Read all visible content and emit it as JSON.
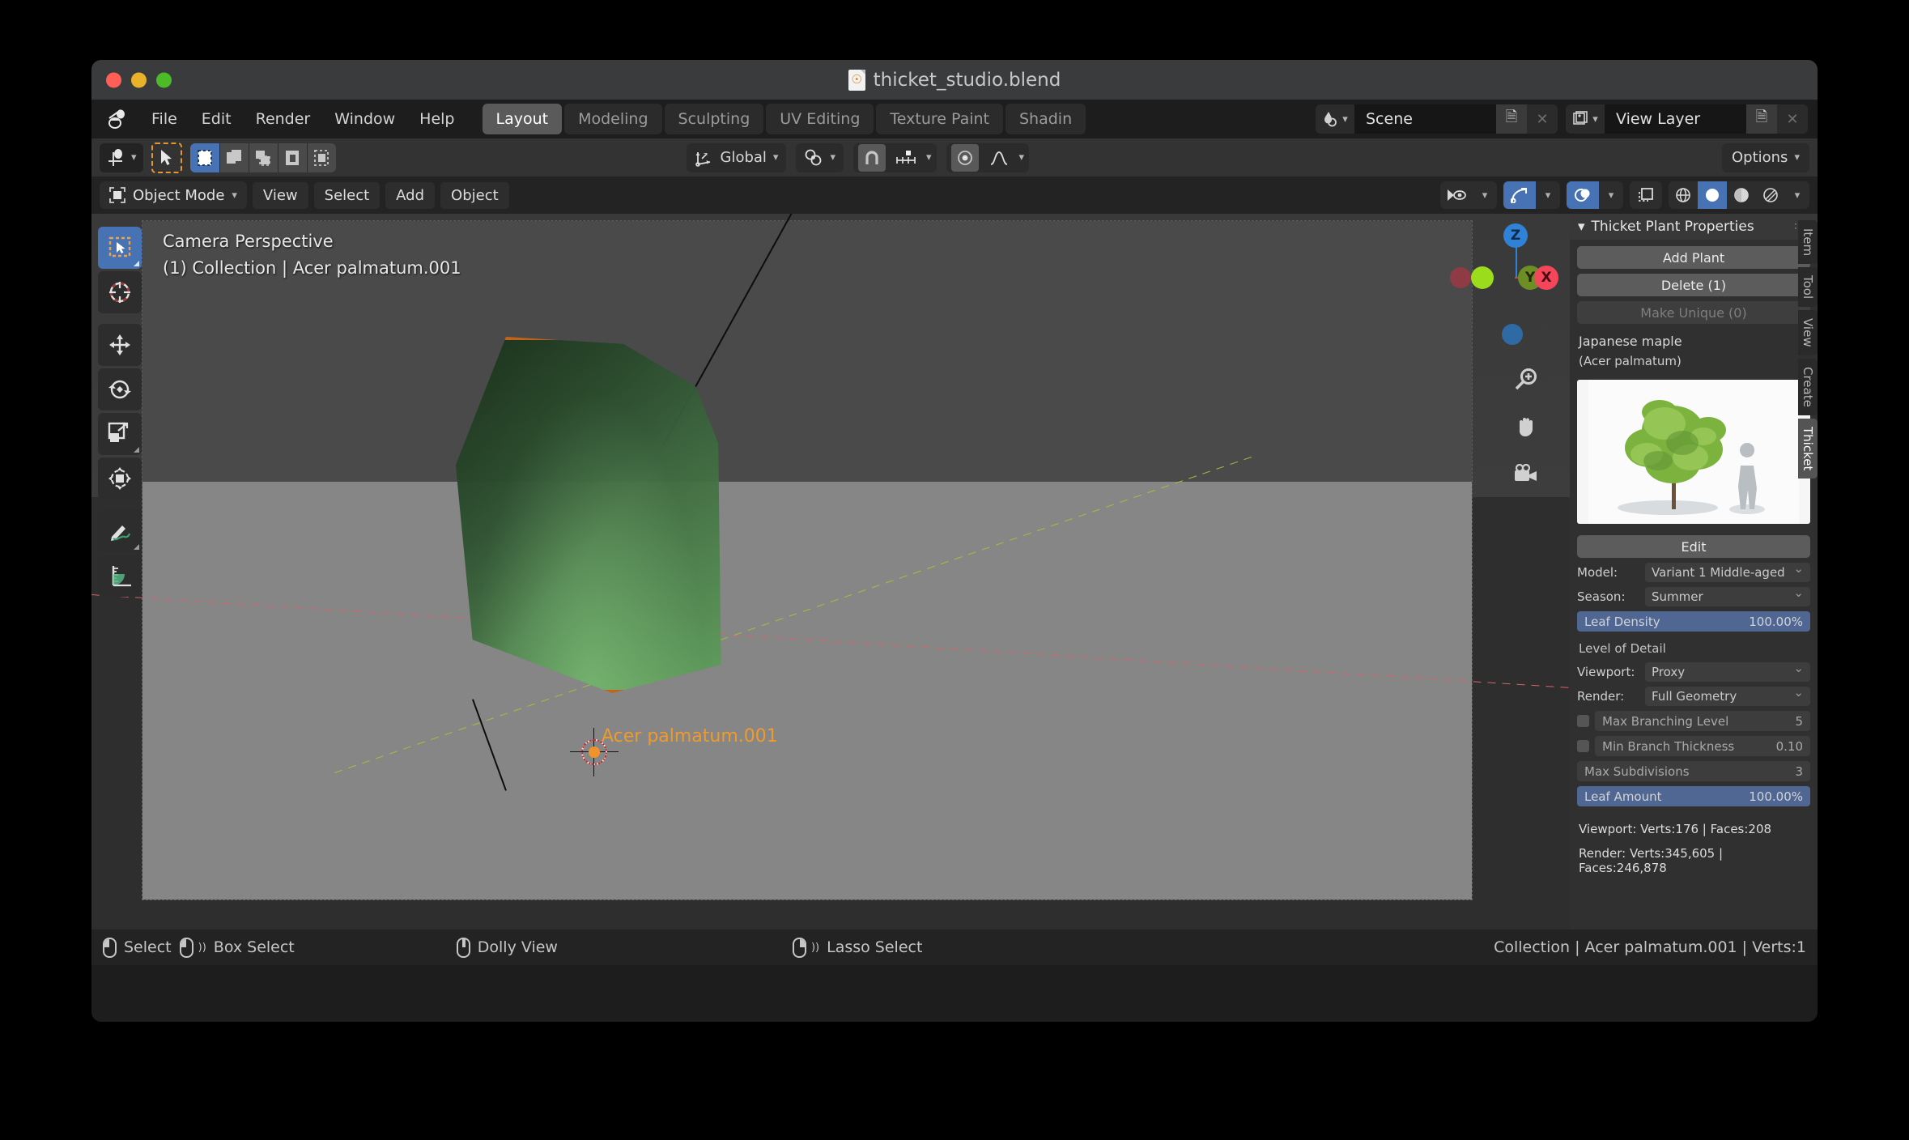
{
  "window": {
    "title": "thicket_studio.blend",
    "traffic_lights": [
      "close",
      "minimize",
      "maximize"
    ]
  },
  "topbar": {
    "logo": "blender-logo",
    "menus": [
      "File",
      "Edit",
      "Render",
      "Window",
      "Help"
    ],
    "workspaces": [
      {
        "label": "Layout",
        "active": true
      },
      {
        "label": "Modeling",
        "active": false
      },
      {
        "label": "Sculpting",
        "active": false
      },
      {
        "label": "UV Editing",
        "active": false
      },
      {
        "label": "Texture Paint",
        "active": false
      },
      {
        "label": "Shadin",
        "active": false
      }
    ],
    "scene": {
      "icon": "scene-icon",
      "name": "Scene",
      "new_label": "new-id",
      "unlink_label": "x"
    },
    "view_layer": {
      "icon": "view-layer-icon",
      "name": "View Layer",
      "new_label": "new-id",
      "unlink_label": "x"
    }
  },
  "tool_header": {
    "transform_orientation": "Global",
    "snap_icon": "magnet-icon",
    "proportional_icon": "proportional-edit-icon",
    "options_label": "Options",
    "select_modes": [
      "set",
      "extend",
      "subtract",
      "invert",
      "intersect"
    ],
    "active_select_mode": 0
  },
  "viewport_header": {
    "mode": "Object Mode",
    "menus": [
      "View",
      "Select",
      "Add",
      "Object"
    ],
    "visibility_icon": "show-hide-icon",
    "gizmo_icon": "gizmo-icon",
    "overlays_icon": "overlays-icon",
    "xray_icon": "xray-icon",
    "shading_modes": [
      "wireframe",
      "solid",
      "material-preview",
      "rendered"
    ],
    "active_shading": 1
  },
  "viewport": {
    "overlay_line1": "Camera Perspective",
    "overlay_line2": "(1) Collection | Acer palmatum.001",
    "object_label": "Acer palmatum.001",
    "gizmo": {
      "z": "Z",
      "y": "Y",
      "x": "X"
    },
    "nav_icons": [
      "zoom-icon",
      "hand-icon",
      "camera-icon"
    ],
    "tools": [
      "tweak-tool",
      "cursor-tool",
      "move-tool",
      "rotate-tool",
      "scale-tool",
      "transform-tool",
      "annotate-tool",
      "measure-tool"
    ],
    "proxy_outline_color": "#c0641a",
    "proxy_fill_color": "#4d8a4f"
  },
  "sidebar": {
    "panel_title": "Thicket Plant Properties",
    "buttons": [
      {
        "label": "Add Plant",
        "disabled": false
      },
      {
        "label": "Delete (1)",
        "disabled": false
      },
      {
        "label": "Make Unique (0)",
        "disabled": true
      }
    ],
    "species_common": "Japanese maple",
    "species_latin": "(Acer palmatum)",
    "thumbnail_alt": "japanese-maple-preview",
    "edit_label": "Edit",
    "model_row": {
      "label": "Model:",
      "value": "Variant 1 Middle-aged"
    },
    "season_row": {
      "label": "Season:",
      "value": "Summer"
    },
    "leaf_density": {
      "label": "Leaf Density",
      "value": "100.00%"
    },
    "lod_header": "Level of Detail",
    "viewport_row": {
      "label": "Viewport:",
      "value": "Proxy"
    },
    "render_row": {
      "label": "Render:",
      "value": "Full Geometry"
    },
    "max_branching": {
      "label": "Max Branching Level",
      "value": "5"
    },
    "min_thickness": {
      "label": "Min Branch Thickness",
      "value": "0.10"
    },
    "max_subdiv": {
      "label": "Max Subdivisions",
      "value": "3"
    },
    "leaf_amount": {
      "label": "Leaf Amount",
      "value": "100.00%"
    },
    "stat_viewport": "Viewport: Verts:176 | Faces:208",
    "stat_render": "Render: Verts:345,605 | Faces:246,878",
    "tabs": [
      {
        "label": "Item",
        "active": false
      },
      {
        "label": "Tool",
        "active": false
      },
      {
        "label": "View",
        "active": false
      },
      {
        "label": "Create",
        "active": false
      },
      {
        "label": "Thicket",
        "active": true
      }
    ],
    "accent_color": "#4f6792"
  },
  "statusbar": {
    "hints": [
      {
        "mouse": "left",
        "label": "Select"
      },
      {
        "mouse": "left-drag",
        "label": "Box Select"
      },
      {
        "mouse": "middle",
        "label": "Dolly View"
      },
      {
        "mouse": "right-drag",
        "label": "Lasso Select"
      }
    ],
    "info": "Collection | Acer palmatum.001 | Verts:1"
  }
}
